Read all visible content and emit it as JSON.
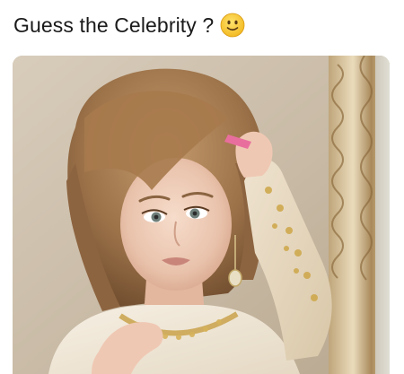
{
  "post": {
    "caption": "Guess the Celebrity ?",
    "caption_icon": "slightly-smiling-face-icon",
    "image_subject": "photo-image"
  },
  "colors": {
    "caption_text": "#1a1a1a",
    "emoji_face": "#f7c531",
    "background": "#ffffff"
  }
}
